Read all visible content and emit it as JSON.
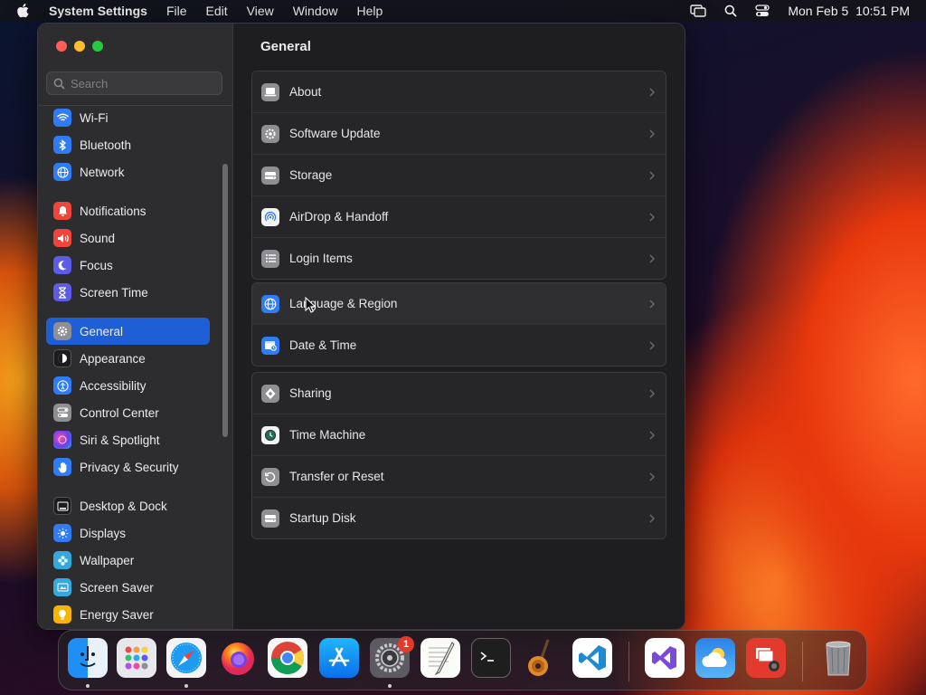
{
  "menubar": {
    "app_name": "System Settings",
    "menus": [
      "File",
      "Edit",
      "View",
      "Window",
      "Help"
    ],
    "clock": "Mon Feb 5  10:51 PM",
    "status_icons": [
      "screen-mirroring-icon",
      "spotlight-search-icon",
      "control-center-icon"
    ]
  },
  "sidebar": {
    "search_placeholder": "Search",
    "items": [
      {
        "label": "Wi-Fi",
        "icon": "wifi-icon",
        "color": "#2f7cf6"
      },
      {
        "label": "Bluetooth",
        "icon": "bluetooth-icon",
        "color": "#2f7cf6"
      },
      {
        "label": "Network",
        "icon": "globe-network-icon",
        "color": "#2f7cf6"
      },
      {
        "label": "Notifications",
        "icon": "bell-icon",
        "color": "#f0453a"
      },
      {
        "label": "Sound",
        "icon": "speaker-icon",
        "color": "#f0453a"
      },
      {
        "label": "Focus",
        "icon": "moon-icon",
        "color": "#5d5ce6"
      },
      {
        "label": "Screen Time",
        "icon": "hourglass-icon",
        "color": "#5d5ce6"
      },
      {
        "label": "General",
        "icon": "gear-icon",
        "color": "#8e8e93",
        "selected": true
      },
      {
        "label": "Appearance",
        "icon": "appearance-icon",
        "color": "#1c1c1e"
      },
      {
        "label": "Accessibility",
        "icon": "accessibility-icon",
        "color": "#2f7cf6"
      },
      {
        "label": "Control Center",
        "icon": "toggles-icon",
        "color": "#8e8e93"
      },
      {
        "label": "Siri & Spotlight",
        "icon": "siri-icon",
        "color": "#b042e8"
      },
      {
        "label": "Privacy & Security",
        "icon": "hand-icon",
        "color": "#2f7cf6"
      },
      {
        "label": "Desktop & Dock",
        "icon": "dock-icon",
        "color": "#1c1c1e"
      },
      {
        "label": "Displays",
        "icon": "sun-icon",
        "color": "#2f7cf6"
      },
      {
        "label": "Wallpaper",
        "icon": "flower-icon",
        "color": "#34aadc"
      },
      {
        "label": "Screen Saver",
        "icon": "screen-saver-icon",
        "color": "#34aadc"
      },
      {
        "label": "Energy Saver",
        "icon": "lightbulb-icon",
        "color": "#f7b500"
      }
    ]
  },
  "main": {
    "title": "General",
    "groups": [
      [
        {
          "label": "About",
          "icon": "laptop-icon"
        },
        {
          "label": "Software Update",
          "icon": "update-gear-icon"
        },
        {
          "label": "Storage",
          "icon": "drive-icon"
        },
        {
          "label": "AirDrop & Handoff",
          "icon": "airdrop-icon"
        },
        {
          "label": "Login Items",
          "icon": "list-icon"
        }
      ],
      [
        {
          "label": "Language & Region",
          "icon": "globe-icon"
        },
        {
          "label": "Date & Time",
          "icon": "calendar-clock-icon"
        }
      ],
      [
        {
          "label": "Sharing",
          "icon": "sharing-icon"
        },
        {
          "label": "Time Machine",
          "icon": "time-machine-icon"
        },
        {
          "label": "Transfer or Reset",
          "icon": "reset-icon"
        },
        {
          "label": "Startup Disk",
          "icon": "disk-icon"
        }
      ]
    ]
  },
  "dock": {
    "apps": [
      {
        "name": "Finder",
        "icon": "finder-icon",
        "running": true
      },
      {
        "name": "Launchpad",
        "icon": "launchpad-icon"
      },
      {
        "name": "Safari",
        "icon": "safari-icon",
        "running": true
      },
      {
        "name": "Firefox",
        "icon": "firefox-icon"
      },
      {
        "name": "Chrome",
        "icon": "chrome-icon"
      },
      {
        "name": "App Store",
        "icon": "app-store-icon"
      },
      {
        "name": "System Settings",
        "icon": "system-settings-icon",
        "running": true,
        "badge": "1"
      },
      {
        "name": "TextEdit",
        "icon": "textedit-icon"
      },
      {
        "name": "Terminal",
        "icon": "terminal-icon"
      },
      {
        "name": "GarageBand",
        "icon": "garageband-icon"
      },
      {
        "name": "Visual Studio Code",
        "icon": "vscode-icon"
      },
      {
        "name": "Visual Studio",
        "icon": "visual-studio-icon"
      },
      {
        "name": "Weather",
        "icon": "weather-icon"
      },
      {
        "name": "Photo Booth",
        "icon": "photo-booth-icon"
      },
      {
        "name": "Trash",
        "icon": "trash-icon"
      }
    ]
  }
}
